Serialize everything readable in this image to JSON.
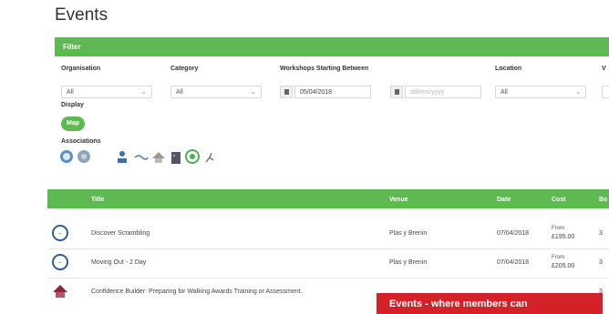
{
  "page": {
    "title": "Events"
  },
  "filter": {
    "header": "Filter",
    "organisation": {
      "label": "Organisation",
      "value": "All"
    },
    "category": {
      "label": "Category",
      "value": "All"
    },
    "workshops": {
      "label": "Workshops Starting Between",
      "from": "05/04/2018",
      "to_placeholder": "dd/mm/yyyy"
    },
    "location": {
      "label": "Location",
      "value": "All"
    },
    "extra_label": "V",
    "display": {
      "label": "Display",
      "button": "Map"
    },
    "associations": {
      "label": "Associations",
      "icons": [
        "ntc-badge-icon",
        "grey-badge-icon",
        "person-logo-icon",
        "wave-icon",
        "house-logo-icon",
        "building-icon",
        "green-circle-icon",
        "runner-logo-icon"
      ]
    }
  },
  "table": {
    "columns": [
      "Title",
      "Venue",
      "Date",
      "Cost",
      "Bo"
    ],
    "rows": [
      {
        "logo": "ntc-logo-icon",
        "title": "Discover Scrambling",
        "venue": "Plas y Brenin",
        "date": "07/04/2018",
        "cost_from": "From",
        "cost": "£195.00",
        "extra": "3"
      },
      {
        "logo": "ntc-logo-icon",
        "title": "Moving Out - 2 Day",
        "venue": "Plas y Brenin",
        "date": "07/04/2018",
        "cost_from": "From",
        "cost": "£205.00",
        "extra": "3"
      },
      {
        "logo": "house-logo-icon",
        "title": "Confidence Builder: Preparing for Walking Awards Training or Assessment.",
        "venue": "",
        "date": "",
        "cost_from": "",
        "cost": "",
        "extra": "3"
      }
    ]
  },
  "banner": {
    "text": "Events - where members can"
  },
  "colors": {
    "accent": "#5fb953",
    "banner": "#d42127"
  }
}
